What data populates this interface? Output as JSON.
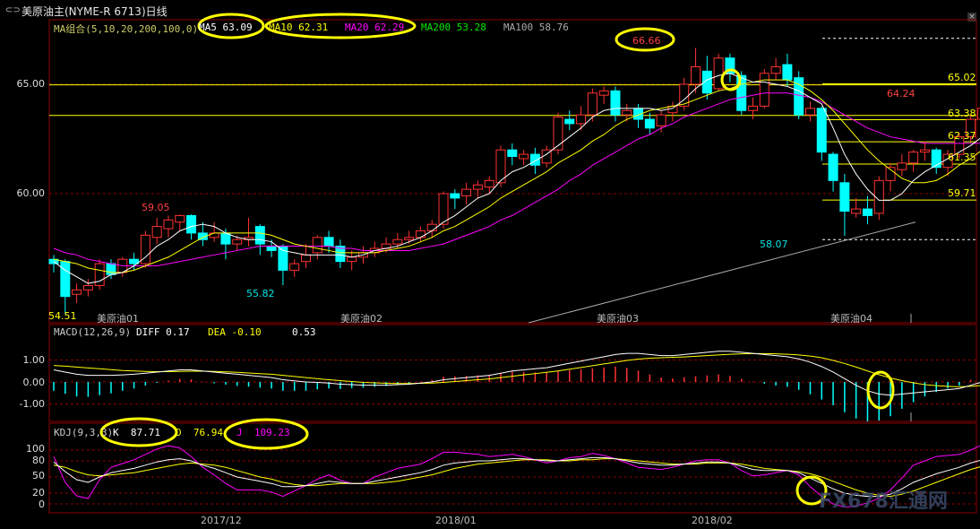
{
  "window": {
    "title": "美原油主(NYME-R 6713)日线"
  },
  "main_panel": {
    "indicator_header": "MA组合(5,10,20,200,100,0)",
    "ma_values": [
      {
        "name": "MA5",
        "value": "63.09",
        "color": "#ffffff"
      },
      {
        "name": "MA10",
        "value": "62.31",
        "color": "#ffff00"
      },
      {
        "name": "MA20",
        "value": "62.29",
        "color": "#ff00ff"
      },
      {
        "name": "MA200",
        "value": "53.28",
        "color": "#00ff00"
      },
      {
        "name": "MA100",
        "value": "58.76",
        "color": "#aaaaaa"
      }
    ],
    "y_ticks": [
      "65.00",
      "60.00"
    ],
    "annotations": {
      "high": "66.66",
      "low_right": "58.07",
      "peak_left": "59.05",
      "low_left": "55.82",
      "last_high": "64.24",
      "bottom_left_corner": "54.51"
    },
    "levels": [
      "65.02",
      "63.38",
      "62.37",
      "61.35",
      "59.71"
    ],
    "contract_labels": [
      "美原油01",
      "美原油02",
      "美原油03",
      "美原油04"
    ]
  },
  "macd_panel": {
    "header": "MACD(12,26,9)",
    "diff_label": "DIFF",
    "diff_value": "0.17",
    "dea_label": "DEA",
    "dea_value": "-0.10",
    "macd_value": "0.53",
    "y_ticks": [
      "1.00",
      "0.00",
      "-1.00"
    ]
  },
  "kdj_panel": {
    "header": "KDJ(9,3,3)",
    "k_label": "K",
    "k_value": "87.71",
    "d_label": "D",
    "d_value": "76.94",
    "j_label": "J",
    "j_value": "109.23",
    "y_ticks": [
      "100",
      "80",
      "50",
      "20",
      "0"
    ]
  },
  "x_axis": {
    "dates": [
      "2017/12",
      "2018/01",
      "2018/02"
    ]
  },
  "watermark": "FX678汇通网",
  "colors": {
    "up": "#ff3232",
    "down": "#00ffff",
    "ma5": "#ffffff",
    "ma10": "#ffff00",
    "ma20": "#ff00ff",
    "ma100": "#aaaaaa",
    "grid": "#8b0000",
    "highlight": "#ffff00"
  },
  "chart_data": {
    "type": "candlestick",
    "title": "美原油主(NYME-R 6713)日线",
    "ylim": [
      54.0,
      67.5
    ],
    "candles": [
      {
        "o": 57.0,
        "c": 56.8,
        "h": 57.2,
        "l": 56.4
      },
      {
        "o": 56.9,
        "c": 55.3,
        "h": 57.0,
        "l": 54.5
      },
      {
        "o": 55.4,
        "c": 55.6,
        "h": 55.9,
        "l": 55.0
      },
      {
        "o": 55.6,
        "c": 55.8,
        "h": 56.1,
        "l": 55.3
      },
      {
        "o": 55.8,
        "c": 56.8,
        "h": 57.0,
        "l": 55.6
      },
      {
        "o": 56.8,
        "c": 56.3,
        "h": 57.0,
        "l": 56.1
      },
      {
        "o": 56.4,
        "c": 57.0,
        "h": 57.1,
        "l": 56.2
      },
      {
        "o": 57.0,
        "c": 56.8,
        "h": 57.3,
        "l": 56.5
      },
      {
        "o": 56.8,
        "c": 58.1,
        "h": 58.3,
        "l": 56.6
      },
      {
        "o": 58.0,
        "c": 58.5,
        "h": 58.9,
        "l": 57.7
      },
      {
        "o": 58.4,
        "c": 58.8,
        "h": 59.0,
        "l": 58.0
      },
      {
        "o": 58.7,
        "c": 59.0,
        "h": 59.05,
        "l": 58.3
      },
      {
        "o": 59.0,
        "c": 58.2,
        "h": 59.05,
        "l": 57.9
      },
      {
        "o": 58.2,
        "c": 57.9,
        "h": 58.7,
        "l": 57.6
      },
      {
        "o": 58.0,
        "c": 58.2,
        "h": 58.7,
        "l": 57.8
      },
      {
        "o": 58.2,
        "c": 57.7,
        "h": 58.4,
        "l": 57.0
      },
      {
        "o": 57.7,
        "c": 57.9,
        "h": 58.1,
        "l": 57.4
      },
      {
        "o": 57.9,
        "c": 58.0,
        "h": 58.9,
        "l": 57.6
      },
      {
        "o": 58.5,
        "c": 57.7,
        "h": 58.6,
        "l": 57.2
      },
      {
        "o": 57.6,
        "c": 57.4,
        "h": 57.9,
        "l": 57.1
      },
      {
        "o": 57.6,
        "c": 56.5,
        "h": 57.7,
        "l": 55.82
      },
      {
        "o": 56.5,
        "c": 56.8,
        "h": 57.0,
        "l": 56.2
      },
      {
        "o": 56.9,
        "c": 57.2,
        "h": 57.7,
        "l": 56.6
      },
      {
        "o": 57.3,
        "c": 58.0,
        "h": 58.1,
        "l": 57.0
      },
      {
        "o": 58.0,
        "c": 57.6,
        "h": 58.3,
        "l": 57.3
      },
      {
        "o": 57.6,
        "c": 56.9,
        "h": 57.9,
        "l": 56.6
      },
      {
        "o": 56.9,
        "c": 57.1,
        "h": 57.4,
        "l": 56.5
      },
      {
        "o": 57.1,
        "c": 57.3,
        "h": 57.6,
        "l": 56.8
      },
      {
        "o": 57.3,
        "c": 57.5,
        "h": 57.8,
        "l": 57.1
      },
      {
        "o": 57.5,
        "c": 57.7,
        "h": 58.0,
        "l": 57.3
      },
      {
        "o": 57.7,
        "c": 57.9,
        "h": 58.2,
        "l": 57.5
      },
      {
        "o": 57.9,
        "c": 58.0,
        "h": 58.3,
        "l": 57.7
      },
      {
        "o": 58.0,
        "c": 58.3,
        "h": 58.5,
        "l": 57.8
      },
      {
        "o": 58.3,
        "c": 58.6,
        "h": 58.8,
        "l": 58.0
      },
      {
        "o": 58.6,
        "c": 60.0,
        "h": 60.1,
        "l": 58.4
      },
      {
        "o": 60.0,
        "c": 59.8,
        "h": 60.2,
        "l": 59.3
      },
      {
        "o": 59.9,
        "c": 60.2,
        "h": 60.5,
        "l": 59.5
      },
      {
        "o": 60.2,
        "c": 60.4,
        "h": 60.6,
        "l": 59.8
      },
      {
        "o": 60.3,
        "c": 60.6,
        "h": 60.8,
        "l": 60.0
      },
      {
        "o": 60.5,
        "c": 62.0,
        "h": 62.2,
        "l": 60.3
      },
      {
        "o": 62.0,
        "c": 61.7,
        "h": 62.3,
        "l": 61.3
      },
      {
        "o": 61.6,
        "c": 61.8,
        "h": 62.0,
        "l": 61.3
      },
      {
        "o": 61.8,
        "c": 61.3,
        "h": 62.1,
        "l": 60.9
      },
      {
        "o": 61.4,
        "c": 62.0,
        "h": 62.2,
        "l": 61.2
      },
      {
        "o": 62.0,
        "c": 63.5,
        "h": 63.7,
        "l": 61.8
      },
      {
        "o": 63.4,
        "c": 63.2,
        "h": 63.8,
        "l": 62.9
      },
      {
        "o": 63.2,
        "c": 63.6,
        "h": 64.0,
        "l": 62.9
      },
      {
        "o": 63.6,
        "c": 64.6,
        "h": 64.8,
        "l": 63.3
      },
      {
        "o": 64.5,
        "c": 64.7,
        "h": 64.9,
        "l": 64.1
      },
      {
        "o": 64.7,
        "c": 63.6,
        "h": 64.9,
        "l": 63.3
      },
      {
        "o": 63.6,
        "c": 63.8,
        "h": 64.1,
        "l": 63.3
      },
      {
        "o": 63.9,
        "c": 63.4,
        "h": 64.1,
        "l": 63.0
      },
      {
        "o": 63.4,
        "c": 63.0,
        "h": 63.7,
        "l": 62.7
      },
      {
        "o": 63.1,
        "c": 63.6,
        "h": 63.8,
        "l": 62.8
      },
      {
        "o": 63.7,
        "c": 64.0,
        "h": 64.2,
        "l": 63.3
      },
      {
        "o": 64.0,
        "c": 65.0,
        "h": 65.3,
        "l": 63.8
      },
      {
        "o": 65.0,
        "c": 65.8,
        "h": 66.66,
        "l": 64.6
      },
      {
        "o": 65.6,
        "c": 64.6,
        "h": 66.3,
        "l": 64.3
      },
      {
        "o": 64.8,
        "c": 66.2,
        "h": 66.4,
        "l": 64.7
      },
      {
        "o": 66.2,
        "c": 65.5,
        "h": 66.4,
        "l": 65.1
      },
      {
        "o": 65.4,
        "c": 63.8,
        "h": 65.6,
        "l": 63.6
      },
      {
        "o": 63.8,
        "c": 64.0,
        "h": 64.4,
        "l": 63.4
      },
      {
        "o": 64.0,
        "c": 65.5,
        "h": 65.7,
        "l": 63.9
      },
      {
        "o": 65.5,
        "c": 65.8,
        "h": 66.2,
        "l": 65.2
      },
      {
        "o": 65.9,
        "c": 65.2,
        "h": 66.4,
        "l": 64.9
      },
      {
        "o": 65.3,
        "c": 63.6,
        "h": 65.6,
        "l": 63.4
      },
      {
        "o": 63.6,
        "c": 63.9,
        "h": 64.2,
        "l": 63.3
      },
      {
        "o": 63.9,
        "c": 61.9,
        "h": 64.0,
        "l": 61.5
      },
      {
        "o": 61.8,
        "c": 60.6,
        "h": 61.9,
        "l": 60.1
      },
      {
        "o": 60.5,
        "c": 59.2,
        "h": 60.9,
        "l": 58.07
      },
      {
        "o": 59.1,
        "c": 59.3,
        "h": 59.8,
        "l": 58.9
      },
      {
        "o": 59.3,
        "c": 59.0,
        "h": 59.9,
        "l": 58.6
      },
      {
        "o": 59.1,
        "c": 60.6,
        "h": 60.8,
        "l": 58.8
      },
      {
        "o": 60.6,
        "c": 61.2,
        "h": 61.4,
        "l": 60.1
      },
      {
        "o": 61.1,
        "c": 61.4,
        "h": 61.8,
        "l": 60.8
      },
      {
        "o": 61.4,
        "c": 61.9,
        "h": 62.0,
        "l": 61.0
      },
      {
        "o": 61.9,
        "c": 62.0,
        "h": 62.4,
        "l": 61.5
      },
      {
        "o": 62.0,
        "c": 61.2,
        "h": 62.1,
        "l": 60.9
      },
      {
        "o": 61.2,
        "c": 61.8,
        "h": 62.0,
        "l": 60.8
      },
      {
        "o": 61.8,
        "c": 62.6,
        "h": 62.8,
        "l": 61.6
      },
      {
        "o": 62.6,
        "c": 63.4,
        "h": 63.6,
        "l": 62.4
      },
      {
        "o": 63.4,
        "c": 63.9,
        "h": 64.24,
        "l": 63.2
      },
      {
        "o": 64.0,
        "c": 63.8,
        "h": 64.24,
        "l": 63.6
      }
    ],
    "ma5": [
      56.9,
      56.5,
      56.2,
      55.9,
      56.0,
      56.3,
      56.4,
      56.7,
      57.1,
      57.6,
      57.9,
      58.3,
      58.5,
      58.6,
      58.5,
      58.2,
      58.0,
      57.9,
      57.9,
      57.8,
      57.4,
      57.3,
      57.2,
      57.2,
      57.2,
      57.2,
      57.1,
      57.2,
      57.4,
      57.5,
      57.6,
      57.8,
      58.0,
      58.3,
      58.7,
      59.0,
      59.4,
      59.8,
      60.0,
      60.6,
      61.0,
      61.2,
      61.5,
      61.8,
      62.2,
      62.6,
      63.0,
      63.5,
      63.8,
      63.9,
      63.9,
      63.9,
      63.9,
      63.8,
      63.9,
      64.3,
      64.8,
      65.2,
      65.4,
      65.5,
      65.3,
      65.1,
      65.1,
      65.0,
      64.9,
      64.7,
      64.4,
      64.1,
      63.0,
      61.8,
      60.9,
      60.2,
      59.7,
      59.7,
      60.0,
      60.6,
      61.0,
      61.3,
      61.6,
      61.9,
      62.2,
      62.6,
      63.09
    ],
    "ma10": [
      57.0,
      56.9,
      56.8,
      56.6,
      56.5,
      56.4,
      56.4,
      56.5,
      56.7,
      56.9,
      57.1,
      57.4,
      57.7,
      58.0,
      58.2,
      58.2,
      58.2,
      58.2,
      58.2,
      58.1,
      57.9,
      57.7,
      57.6,
      57.5,
      57.4,
      57.3,
      57.3,
      57.3,
      57.3,
      57.4,
      57.5,
      57.6,
      57.8,
      58.0,
      58.3,
      58.5,
      58.8,
      59.1,
      59.4,
      59.8,
      60.1,
      60.4,
      60.7,
      61.0,
      61.4,
      61.7,
      62.0,
      62.4,
      62.7,
      63.1,
      63.4,
      63.6,
      63.8,
      63.9,
      64.0,
      64.1,
      64.3,
      64.5,
      64.7,
      64.8,
      65.0,
      65.1,
      65.2,
      65.2,
      65.2,
      65.0,
      64.7,
      64.3,
      63.8,
      63.2,
      62.6,
      62.0,
      61.5,
      61.1,
      60.7,
      60.5,
      60.5,
      60.6,
      60.9,
      61.3,
      61.6,
      62.0,
      62.31
    ],
    "ma20": [
      57.5,
      57.3,
      57.2,
      57.0,
      56.9,
      56.8,
      56.7,
      56.7,
      56.7,
      56.7,
      56.8,
      56.9,
      57.0,
      57.1,
      57.2,
      57.3,
      57.4,
      57.5,
      57.6,
      57.6,
      57.6,
      57.6,
      57.6,
      57.6,
      57.6,
      57.5,
      57.5,
      57.4,
      57.4,
      57.4,
      57.4,
      57.4,
      57.5,
      57.6,
      57.7,
      57.9,
      58.1,
      58.3,
      58.5,
      58.8,
      59.0,
      59.3,
      59.6,
      59.9,
      60.2,
      60.6,
      60.9,
      61.3,
      61.6,
      61.9,
      62.2,
      62.5,
      62.7,
      63.0,
      63.2,
      63.5,
      63.7,
      63.9,
      64.1,
      64.3,
      64.4,
      64.5,
      64.6,
      64.6,
      64.6,
      64.5,
      64.4,
      64.2,
      63.9,
      63.6,
      63.3,
      63.0,
      62.8,
      62.6,
      62.5,
      62.4,
      62.3,
      62.3,
      62.3,
      62.3,
      62.3,
      62.3,
      62.29
    ],
    "macd_diff": [
      0.55,
      0.45,
      0.35,
      0.3,
      0.3,
      0.3,
      0.32,
      0.35,
      0.4,
      0.45,
      0.5,
      0.55,
      0.55,
      0.5,
      0.45,
      0.4,
      0.35,
      0.3,
      0.25,
      0.2,
      0.1,
      0.05,
      0.0,
      -0.02,
      -0.05,
      -0.1,
      -0.12,
      -0.15,
      -0.15,
      -0.15,
      -0.12,
      -0.1,
      -0.05,
      0.0,
      0.1,
      0.15,
      0.2,
      0.25,
      0.3,
      0.4,
      0.5,
      0.55,
      0.6,
      0.65,
      0.75,
      0.85,
      0.95,
      1.05,
      1.15,
      1.25,
      1.3,
      1.3,
      1.25,
      1.2,
      1.2,
      1.25,
      1.3,
      1.35,
      1.4,
      1.4,
      1.35,
      1.3,
      1.25,
      1.2,
      1.15,
      1.05,
      0.9,
      0.7,
      0.45,
      0.15,
      -0.15,
      -0.4,
      -0.55,
      -0.6,
      -0.55,
      -0.5,
      -0.45,
      -0.4,
      -0.35,
      -0.3,
      -0.15,
      0.0,
      0.17
    ],
    "macd_dea": [
      0.75,
      0.72,
      0.68,
      0.64,
      0.6,
      0.56,
      0.52,
      0.5,
      0.48,
      0.47,
      0.47,
      0.48,
      0.49,
      0.49,
      0.48,
      0.46,
      0.44,
      0.41,
      0.38,
      0.35,
      0.3,
      0.25,
      0.2,
      0.15,
      0.1,
      0.06,
      0.02,
      -0.02,
      -0.04,
      -0.06,
      -0.07,
      -0.07,
      -0.06,
      -0.05,
      -0.02,
      0.02,
      0.06,
      0.1,
      0.14,
      0.2,
      0.26,
      0.32,
      0.38,
      0.44,
      0.5,
      0.58,
      0.66,
      0.74,
      0.82,
      0.9,
      0.98,
      1.04,
      1.08,
      1.1,
      1.12,
      1.14,
      1.17,
      1.2,
      1.23,
      1.26,
      1.28,
      1.29,
      1.29,
      1.28,
      1.26,
      1.23,
      1.18,
      1.1,
      0.98,
      0.84,
      0.68,
      0.5,
      0.33,
      0.18,
      0.06,
      -0.04,
      -0.12,
      -0.17,
      -0.2,
      -0.22,
      -0.2,
      -0.16,
      -0.1
    ],
    "kdj_k": [
      78,
      60,
      45,
      40,
      50,
      58,
      62,
      66,
      72,
      78,
      82,
      84,
      80,
      72,
      66,
      58,
      50,
      46,
      42,
      38,
      32,
      32,
      34,
      38,
      42,
      40,
      38,
      38,
      42,
      46,
      50,
      54,
      58,
      64,
      72,
      76,
      78,
      80,
      80,
      82,
      84,
      84,
      82,
      80,
      80,
      82,
      84,
      86,
      86,
      84,
      80,
      76,
      74,
      72,
      72,
      74,
      76,
      78,
      78,
      76,
      70,
      64,
      62,
      62,
      62,
      58,
      48,
      38,
      28,
      20,
      16,
      14,
      14,
      18,
      28,
      40,
      48,
      56,
      62,
      68,
      76,
      82,
      87.71
    ],
    "kdj_d": [
      72,
      68,
      60,
      54,
      52,
      54,
      56,
      58,
      62,
      66,
      70,
      74,
      76,
      74,
      72,
      68,
      62,
      56,
      50,
      46,
      40,
      36,
      34,
      34,
      36,
      38,
      38,
      38,
      38,
      40,
      42,
      46,
      50,
      54,
      60,
      66,
      70,
      74,
      76,
      78,
      80,
      82,
      82,
      82,
      80,
      80,
      82,
      82,
      84,
      84,
      82,
      80,
      78,
      76,
      74,
      74,
      74,
      76,
      76,
      76,
      74,
      70,
      66,
      64,
      62,
      60,
      56,
      50,
      42,
      34,
      26,
      20,
      16,
      14,
      18,
      24,
      32,
      40,
      48,
      56,
      64,
      70,
      76.94
    ],
    "kdj_j": [
      88,
      40,
      15,
      10,
      45,
      68,
      75,
      82,
      92,
      102,
      108,
      104,
      88,
      68,
      54,
      38,
      26,
      26,
      26,
      22,
      14,
      24,
      34,
      46,
      54,
      44,
      38,
      38,
      50,
      58,
      66,
      70,
      74,
      84,
      96,
      96,
      94,
      92,
      88,
      90,
      92,
      88,
      82,
      76,
      80,
      86,
      88,
      94,
      90,
      84,
      76,
      68,
      66,
      64,
      68,
      74,
      80,
      82,
      82,
      76,
      62,
      52,
      54,
      58,
      62,
      54,
      32,
      14,
      0,
      -6,
      -4,
      2,
      10,
      26,
      48,
      72,
      80,
      88,
      90,
      92,
      100,
      110,
      109.23
    ]
  }
}
